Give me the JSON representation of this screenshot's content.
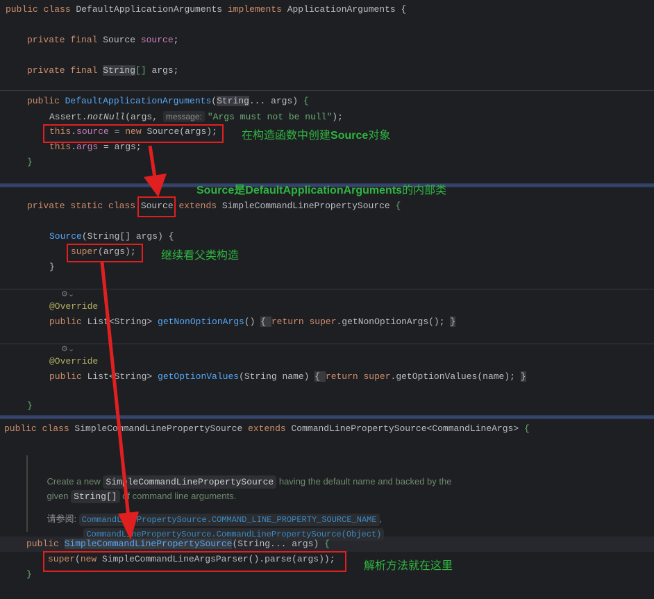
{
  "code_lines": [
    [
      [
        "k",
        "public class "
      ],
      [
        "t",
        "DefaultApplicationArguments "
      ],
      [
        "k",
        "implements "
      ],
      [
        "t",
        "ApplicationArguments "
      ],
      [
        "t",
        "{"
      ]
    ],
    [
      [
        "k",
        "private final "
      ],
      [
        "t",
        "Source "
      ],
      [
        "v",
        "source"
      ],
      [
        "t",
        ";"
      ]
    ],
    [
      [
        "k",
        "private final "
      ],
      [
        "t hl",
        "String"
      ],
      [
        "s",
        "[]"
      ],
      [
        "t",
        " args;"
      ]
    ],
    [
      [
        "k",
        "public "
      ],
      [
        "f",
        "DefaultApplicationArguments"
      ],
      [
        "t",
        "("
      ],
      [
        "t hl",
        "String"
      ],
      [
        "t",
        "... args) "
      ],
      [
        "s",
        "{"
      ]
    ],
    [
      [
        "t",
        "Assert."
      ],
      [
        "t i",
        "notNull"
      ],
      [
        "t",
        "(args, "
      ],
      [
        "hint",
        "message:"
      ],
      [
        "s",
        "\"Args must not be null\""
      ],
      [
        "t",
        ");"
      ]
    ],
    [
      [
        "k",
        "this"
      ],
      [
        "t",
        "."
      ],
      [
        "v",
        "source"
      ],
      [
        "t",
        " = "
      ],
      [
        "k",
        "new "
      ],
      [
        "t",
        "Source(args);"
      ]
    ],
    [
      [
        "k",
        "this"
      ],
      [
        "t",
        "."
      ],
      [
        "v",
        "args"
      ],
      [
        "t",
        " = args;"
      ]
    ],
    [
      [
        "s",
        "}"
      ]
    ],
    [
      [
        "k",
        "private static class "
      ],
      [
        "t",
        "Source"
      ],
      [
        "t",
        " "
      ],
      [
        "k",
        "extends "
      ],
      [
        "t",
        "SimpleCommandLinePropertySource "
      ],
      [
        "s",
        "{"
      ]
    ],
    [
      [
        "f",
        "Source"
      ],
      [
        "t",
        "(String[] args) {"
      ]
    ],
    [
      [
        "k",
        "super"
      ],
      [
        "t",
        "(args);"
      ]
    ],
    [
      [
        "t",
        "}"
      ]
    ],
    [
      [
        "a",
        "@Override"
      ]
    ],
    [
      [
        "k",
        "public "
      ],
      [
        "t",
        "List<String> "
      ],
      [
        "f",
        "getNonOptionArgs"
      ],
      [
        "t",
        "() "
      ],
      [
        "fold",
        "{ "
      ],
      [
        "k",
        "return super"
      ],
      [
        "t",
        ".getNonOptionArgs(); "
      ],
      [
        "fold",
        "}"
      ]
    ],
    [
      [
        "a",
        "@Override"
      ]
    ],
    [
      [
        "k",
        "public "
      ],
      [
        "t",
        "List<String> "
      ],
      [
        "f",
        "getOptionValues"
      ],
      [
        "t",
        "(String name) "
      ],
      [
        "fold",
        "{ "
      ],
      [
        "k",
        "return super"
      ],
      [
        "t",
        ".getOptionValues(name); "
      ],
      [
        "fold",
        "}"
      ]
    ],
    [
      [
        "s",
        "}"
      ]
    ],
    [
      [
        "k",
        "public class "
      ],
      [
        "t",
        "SimpleCommandLinePropertySource "
      ],
      [
        "k",
        "extends "
      ],
      [
        "t",
        "CommandLinePropertySource<CommandLineArgs> "
      ],
      [
        "s",
        "{"
      ]
    ],
    [
      [
        "k",
        "public "
      ],
      [
        "f hl",
        "SimpleCommandLinePropertySource"
      ],
      [
        "t",
        "(String... args) "
      ],
      [
        "s",
        "{"
      ]
    ],
    [
      [
        "k",
        "super"
      ],
      [
        "t",
        "("
      ],
      [
        "k",
        "new "
      ],
      [
        "t",
        "SimpleCommandLineArgsParser().parse(args));"
      ]
    ],
    [
      [
        "s",
        "}"
      ]
    ]
  ],
  "doc": {
    "l1_a": "Create a new ",
    "l1_code": "SimpleCommandLinePropertySource",
    "l1_b": " having the default name and backed by the",
    "l2_a": "given ",
    "l2_code": "String[]",
    "l2_b": " of command line arguments.",
    "see_label": "请参阅:",
    "see_1": "CommandLinePropertySource.COMMAND_LINE_PROPERTY_SOURCE_NAME",
    "see_sep": ",",
    "see_2": "CommandLinePropertySource.CommandLinePropertySource(Object)"
  },
  "notes": {
    "n1_a": "在构造函数中创建",
    "n1_b": "Source",
    "n1_c": "对象",
    "n2_a": "Source",
    "n2_b": "是",
    "n2_c": "DefaultApplicationArguments",
    "n2_d": "的内部类",
    "n3": "继续看父类构造",
    "n4": "解析方法就在这里"
  },
  "colors": {
    "annotation_red": "#e02020",
    "note_green": "#2fb540",
    "background": "#1e1f22"
  }
}
